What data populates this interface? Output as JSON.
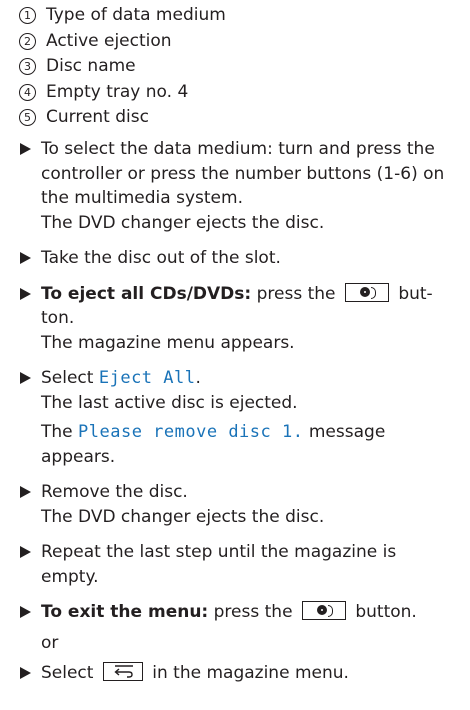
{
  "legend": [
    {
      "num": "1",
      "label": "Type of data medium"
    },
    {
      "num": "2",
      "label": "Active ejection"
    },
    {
      "num": "3",
      "label": "Disc name"
    },
    {
      "num": "4",
      "label": "Empty tray no. 4"
    },
    {
      "num": "5",
      "label": "Current disc"
    }
  ],
  "steps": {
    "s1": "To select the data medium: turn and press the controller or press the number buttons (1-6) on the multimedia system.",
    "s1_result": "The DVD changer ejects the disc.",
    "s2": "Take the disc out of the slot.",
    "s3_bold": "To eject all CDs/DVDs:",
    "s3_pre": "press the",
    "s3_post": "but-",
    "s3_cont": "ton.",
    "s3_result": "The magazine menu appears.",
    "s4_pre": "Select",
    "s4_mono": "Eject All",
    "s4_post": ".",
    "s4_result1": "The last active disc is ejected.",
    "s4_result2_pre": "The",
    "s4_result2_mono": "Please remove disc 1.",
    "s4_result2_post": "message",
    "s4_result2_cont": "appears.",
    "s5": "Remove the disc.",
    "s5_result": "The DVD changer ejects the disc.",
    "s6": "Repeat the last step until the magazine is empty.",
    "s7_bold": "To exit the menu:",
    "s7_pre": "press the",
    "s7_post": "button.",
    "or": "or",
    "s8_pre": "Select",
    "s8_post": "in the magazine menu."
  },
  "icons": {
    "step_marker": "triangle-right-icon",
    "disc_button": "disc-eject-icon",
    "back_button": "back-arrow-icon"
  }
}
